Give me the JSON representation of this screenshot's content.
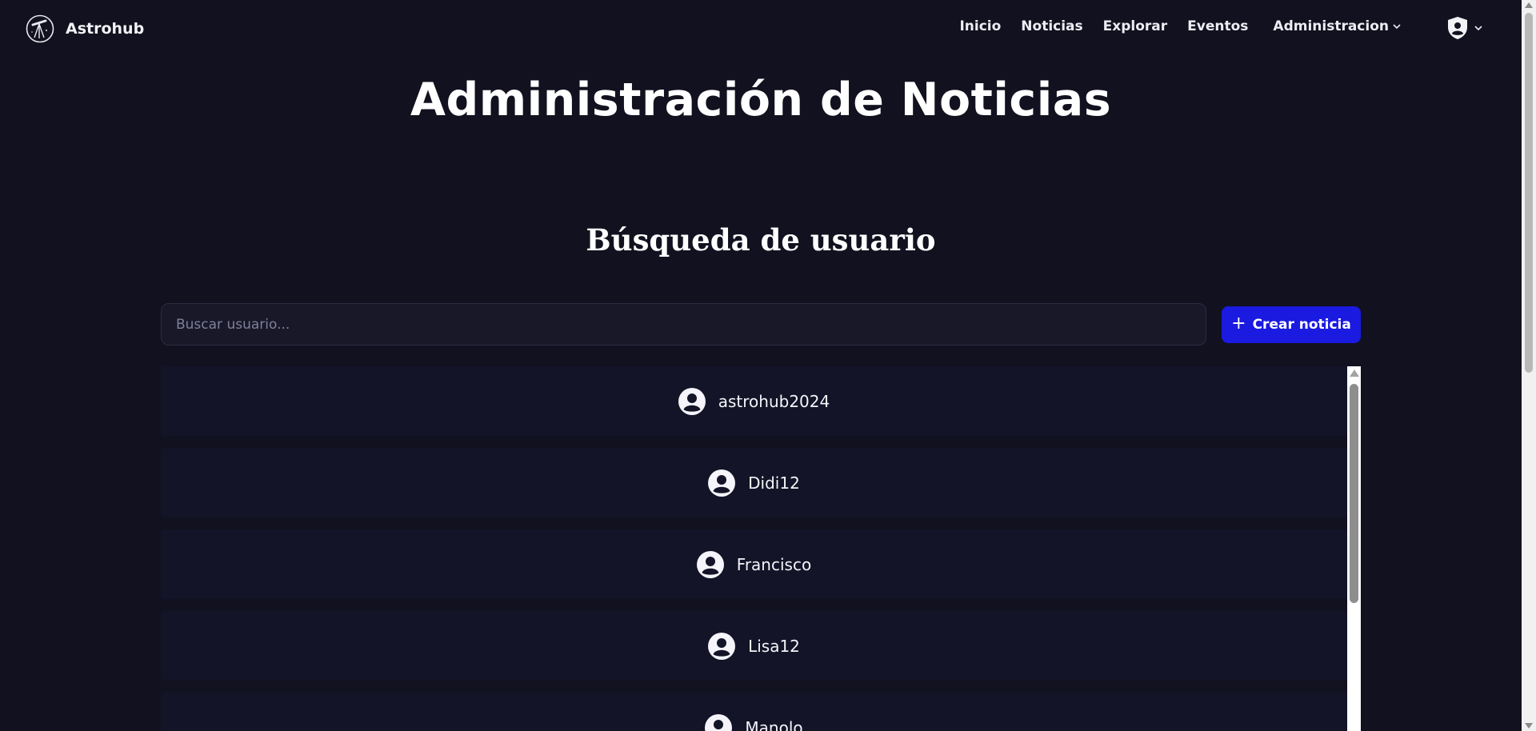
{
  "navbar": {
    "brand": "Astrohub",
    "links": {
      "inicio": "Inicio",
      "noticias": "Noticias",
      "explorar": "Explorar",
      "eventos": "Eventos",
      "administracion": "Administracion"
    },
    "user_menu_icon": "shield-user-icon"
  },
  "page": {
    "title": "Administración de Noticias",
    "section_title": "Búsqueda de usuario"
  },
  "search": {
    "placeholder": "Buscar usuario...",
    "value": ""
  },
  "create_button": {
    "icon": "+",
    "label": "Crear noticia"
  },
  "users": [
    {
      "username": "astrohub2024"
    },
    {
      "username": "Didi12"
    },
    {
      "username": "Francisco"
    },
    {
      "username": "Lisa12"
    },
    {
      "username": "Manolo"
    }
  ],
  "colors": {
    "background": "#11111f",
    "row_background": "#141428",
    "accent": "#1a1ae0",
    "text": "#ffffff"
  }
}
